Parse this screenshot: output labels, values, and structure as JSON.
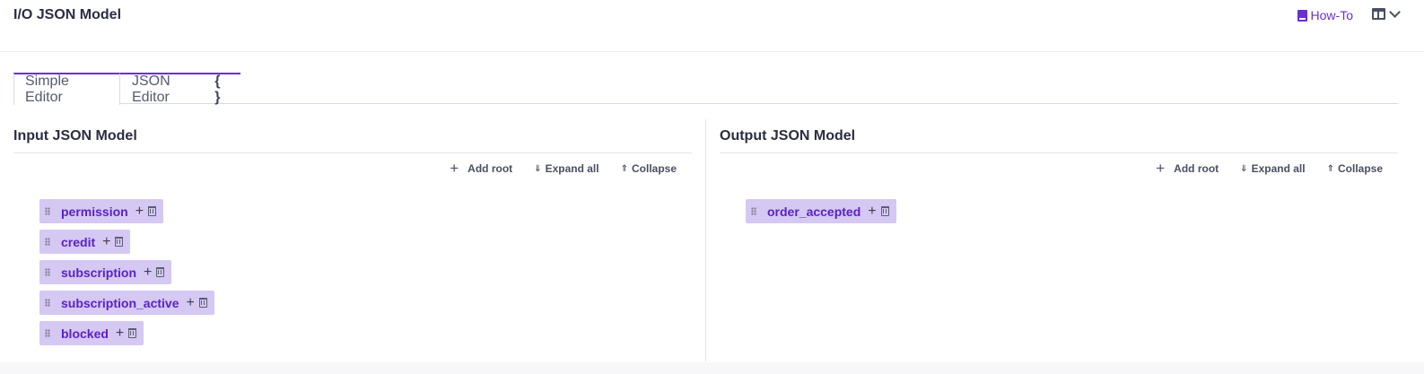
{
  "header": {
    "title": "I/O JSON Model",
    "howto_label": "How-To"
  },
  "tabs": [
    {
      "label": "Simple Editor",
      "active": true
    },
    {
      "label": "JSON Editor",
      "suffix": "{ }",
      "active": false
    }
  ],
  "input_panel": {
    "title": "Input JSON Model",
    "toolbar": {
      "add_root": "Add root",
      "expand_all": "Expand all",
      "collapse": "Collapse"
    },
    "nodes": [
      "permission",
      "credit",
      "subscription",
      "subscription_active",
      "blocked"
    ]
  },
  "output_panel": {
    "title": "Output JSON Model",
    "toolbar": {
      "add_root": "Add root",
      "expand_all": "Expand all",
      "collapse": "Collapse"
    },
    "nodes": [
      "order_accepted"
    ]
  },
  "icons": {
    "howto": "book-icon",
    "layout": "layout-icon",
    "dropdown": "chevron-down-icon",
    "node_drag": "grip-icon",
    "node_add": "plus-icon",
    "node_delete": "trash-icon"
  },
  "colors": {
    "accent": "#6a2fd1",
    "node_bg": "#d5c8f3",
    "node_text": "#5a22c4"
  }
}
